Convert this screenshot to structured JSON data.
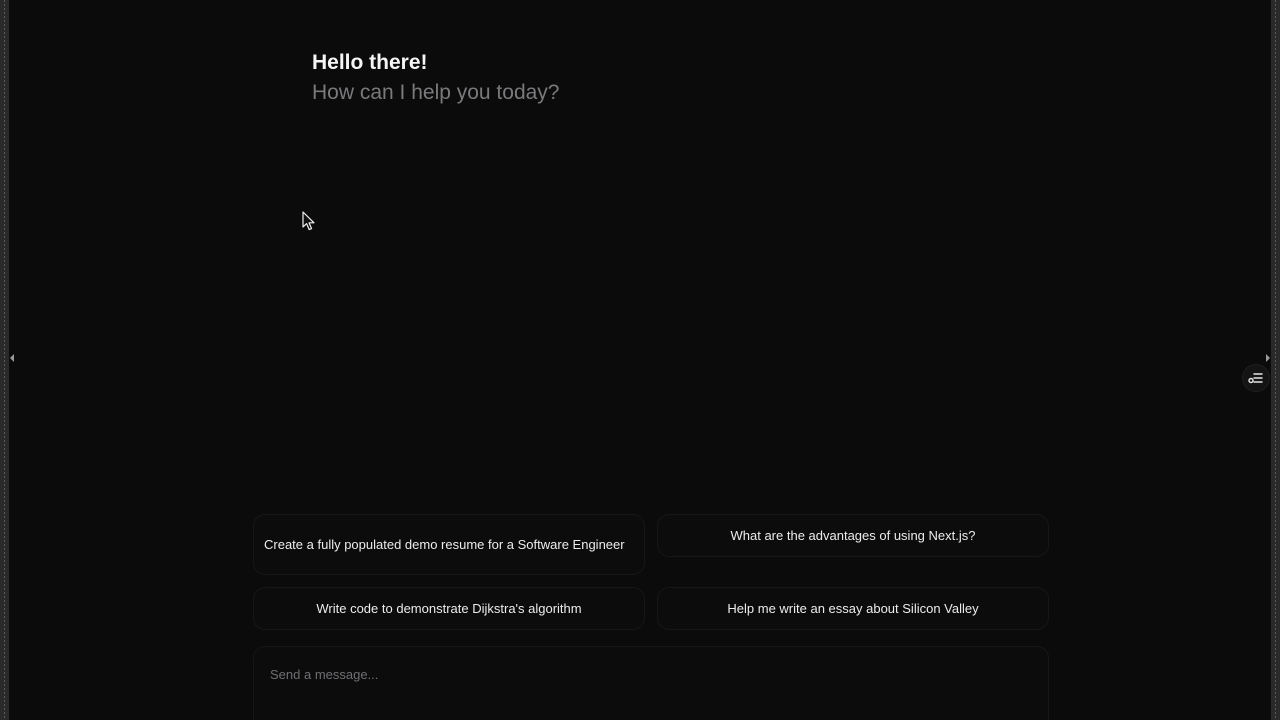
{
  "greeting": {
    "title": "Hello there!",
    "subtitle": "How can I help you today?"
  },
  "sidebar_toggle": {
    "icon": "sliders-icon"
  },
  "suggestions": [
    {
      "text": "Create a fully populated demo resume for a Software Engineer"
    },
    {
      "text": "What are the advantages of using Next.js?"
    },
    {
      "text": "Write code to demonstrate Dijkstra's algorithm"
    },
    {
      "text": "Help me write an essay about Silicon Valley"
    }
  ],
  "composer": {
    "placeholder": "Send a message...",
    "value": ""
  },
  "colors": {
    "background": "#0b0b0c",
    "text_primary": "#f5f5f5",
    "text_muted": "#7a7a7c"
  }
}
